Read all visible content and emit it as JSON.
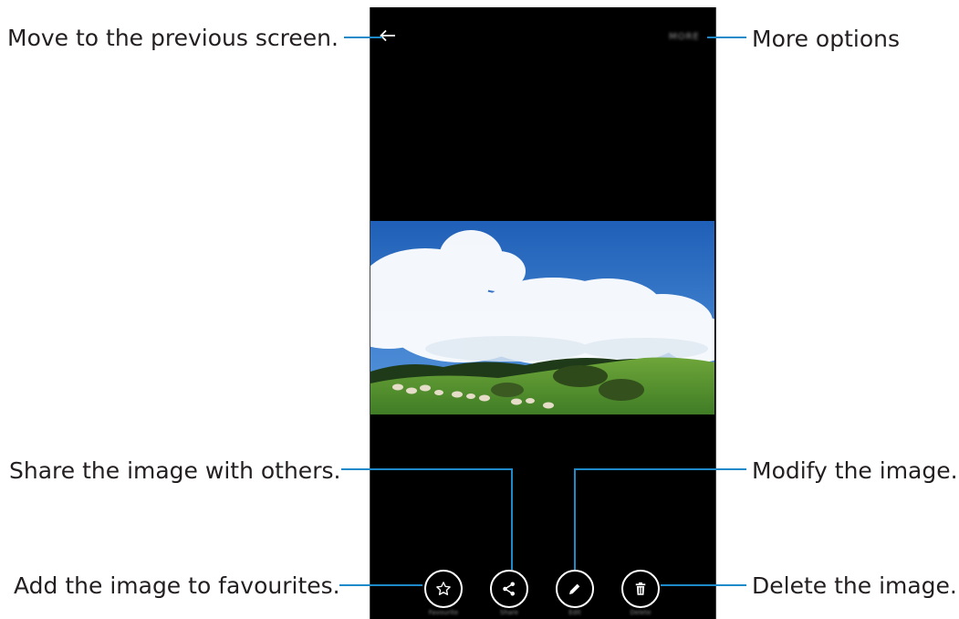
{
  "callouts": {
    "previous_screen": "Move to the previous screen.",
    "more_options": "More options",
    "share": "Share the image with others.",
    "modify": "Modify the image.",
    "favourites": "Add the image to favourites.",
    "delete": "Delete the image."
  },
  "toolbar": {
    "back_icon": "arrow-left-icon",
    "more_label": "MORE"
  },
  "actions": [
    {
      "name": "favourite",
      "label": "Favourite",
      "icon": "star-icon"
    },
    {
      "name": "share",
      "label": "Share",
      "icon": "share-icon"
    },
    {
      "name": "edit",
      "label": "Edit",
      "icon": "pencil-icon"
    },
    {
      "name": "delete",
      "label": "Delete",
      "icon": "trash-icon"
    }
  ],
  "image": {
    "subject": "sky-clouds-hillside-sheep"
  },
  "colors": {
    "screen_bg": "#000000",
    "callout_line": "#1f8ac9",
    "text": "#231f20",
    "sky": "#2f74c4",
    "grass": "#4f8f2c"
  }
}
